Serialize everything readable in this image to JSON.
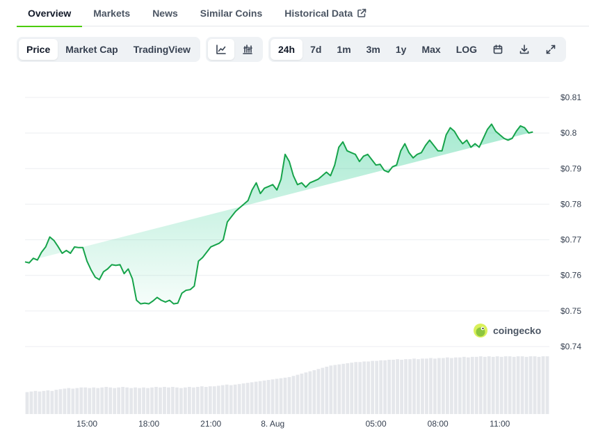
{
  "nav": {
    "tabs": [
      {
        "label": "Overview",
        "active": true
      },
      {
        "label": "Markets",
        "active": false
      },
      {
        "label": "News",
        "active": false
      },
      {
        "label": "Similar Coins",
        "active": false
      },
      {
        "label": "Historical Data",
        "active": false,
        "icon": "external-link-icon"
      }
    ]
  },
  "toolbar": {
    "chart_type": {
      "price": "Price",
      "market_cap": "Market Cap",
      "tradingview": "TradingView",
      "selected": "Price"
    },
    "view_icons": [
      "line-chart-icon",
      "candlestick-chart-icon"
    ],
    "ranges": {
      "r24h": "24h",
      "r7d": "7d",
      "r1m": "1m",
      "r3m": "3m",
      "r1y": "1y",
      "max": "Max",
      "log": "LOG",
      "selected": "24h"
    },
    "action_icons": [
      "calendar-icon",
      "download-icon",
      "fullscreen-icon"
    ]
  },
  "colors": {
    "accent": "#4bcc00",
    "line": "#16a34a",
    "area": "#16c784",
    "volume": "#e5e7eb"
  },
  "watermark": "coingecko",
  "chart_data": {
    "type": "area",
    "ylim": [
      0.74,
      0.81
    ],
    "ytick_values": [
      0.81,
      0.8,
      0.79,
      0.78,
      0.77,
      0.76,
      0.75,
      0.74
    ],
    "yticks": [
      "$0.81",
      "$0.8",
      "$0.79",
      "$0.78",
      "$0.77",
      "$0.76",
      "$0.75",
      "$0.74"
    ],
    "xticks": [
      "15:00",
      "18:00",
      "21:00",
      "8. Aug",
      "05:00",
      "08:00",
      "11:00"
    ],
    "xtick_hours": [
      15,
      18,
      21,
      24,
      29,
      32,
      35
    ],
    "series": [
      {
        "x_hours": [
          12.0,
          12.2,
          12.4,
          12.6,
          12.8,
          13.0,
          13.2,
          13.4,
          13.6,
          13.8,
          14.0,
          14.2,
          14.4,
          14.6,
          14.8,
          15.0,
          15.2,
          15.4,
          15.6,
          15.8,
          16.0,
          16.2,
          16.4,
          16.6,
          16.8,
          17.0,
          17.2,
          17.4,
          17.6,
          17.8,
          18.0,
          18.2,
          18.4,
          18.6,
          18.8,
          19.0,
          19.2,
          19.4,
          19.6,
          19.8,
          20.0,
          20.2,
          20.4,
          20.6,
          20.8,
          21.0,
          21.2,
          21.4,
          21.6,
          21.8,
          22.0,
          22.2,
          22.4,
          22.6,
          22.8,
          23.0,
          23.2,
          23.4,
          23.6,
          23.8,
          24.0,
          24.2,
          24.4,
          24.6,
          24.8,
          25.0,
          25.2,
          25.4,
          25.6,
          25.8,
          26.0,
          26.2,
          26.4,
          26.6,
          26.8,
          27.0,
          27.2,
          27.4,
          27.6,
          27.8,
          28.0,
          28.2,
          28.4,
          28.6,
          28.8,
          29.0,
          29.2,
          29.4,
          29.6,
          29.8,
          30.0,
          30.2,
          30.4,
          30.6,
          30.8,
          31.0,
          31.2,
          31.4,
          31.6,
          31.8,
          32.0,
          32.2,
          32.4,
          32.6,
          32.8,
          33.0,
          33.2,
          33.4,
          33.6,
          33.8,
          34.0,
          34.2,
          34.4,
          34.6,
          34.8,
          35.0,
          35.2,
          35.4,
          35.6,
          35.8,
          36.0,
          36.2,
          36.4,
          36.6,
          36.8,
          37.0,
          37.2,
          37.4
        ],
        "values": [
          0.7638,
          0.7635,
          0.7648,
          0.7643,
          0.7665,
          0.768,
          0.7708,
          0.7698,
          0.7681,
          0.7662,
          0.767,
          0.7662,
          0.768,
          0.7678,
          0.7678,
          0.764,
          0.7615,
          0.7595,
          0.7588,
          0.761,
          0.7618,
          0.763,
          0.7628,
          0.763,
          0.7605,
          0.7618,
          0.759,
          0.753,
          0.752,
          0.7522,
          0.752,
          0.7528,
          0.7538,
          0.753,
          0.7525,
          0.753,
          0.752,
          0.7522,
          0.755,
          0.7558,
          0.756,
          0.757,
          0.764,
          0.765,
          0.7665,
          0.768,
          0.7685,
          0.769,
          0.77,
          0.775,
          0.7765,
          0.778,
          0.779,
          0.78,
          0.781,
          0.784,
          0.786,
          0.783,
          0.7845,
          0.785,
          0.7855,
          0.784,
          0.787,
          0.794,
          0.792,
          0.788,
          0.7855,
          0.786,
          0.7848,
          0.786,
          0.7865,
          0.787,
          0.788,
          0.789,
          0.788,
          0.791,
          0.796,
          0.7975,
          0.795,
          0.7945,
          0.794,
          0.792,
          0.7935,
          0.794,
          0.7925,
          0.791,
          0.7912,
          0.7895,
          0.789,
          0.7905,
          0.791,
          0.795,
          0.797,
          0.7945,
          0.793,
          0.794,
          0.7945,
          0.7965,
          0.798,
          0.7965,
          0.795,
          0.795,
          0.7995,
          0.8015,
          0.8005,
          0.7985,
          0.797,
          0.798,
          0.796,
          0.797,
          0.796,
          0.7985,
          0.801,
          0.8025,
          0.8005,
          0.7995,
          0.7985,
          0.798,
          0.7985,
          0.8005,
          0.802,
          0.8015,
          0.8,
          0.8003
        ]
      }
    ],
    "volume": [
      0.38,
      0.39,
      0.4,
      0.39,
      0.4,
      0.41,
      0.4,
      0.42,
      0.43,
      0.44,
      0.45,
      0.44,
      0.45,
      0.46,
      0.46,
      0.45,
      0.46,
      0.45,
      0.46,
      0.47,
      0.46,
      0.45,
      0.46,
      0.47,
      0.46,
      0.45,
      0.46,
      0.45,
      0.46,
      0.45,
      0.46,
      0.47,
      0.46,
      0.47,
      0.46,
      0.47,
      0.46,
      0.45,
      0.46,
      0.47,
      0.46,
      0.47,
      0.48,
      0.47,
      0.48,
      0.48,
      0.49,
      0.5,
      0.51,
      0.5,
      0.51,
      0.52,
      0.53,
      0.54,
      0.55,
      0.56,
      0.57,
      0.58,
      0.59,
      0.6,
      0.61,
      0.62,
      0.63,
      0.64,
      0.66,
      0.68,
      0.7,
      0.72,
      0.74,
      0.76,
      0.78,
      0.8,
      0.82,
      0.84,
      0.85,
      0.86,
      0.87,
      0.88,
      0.89,
      0.9,
      0.9,
      0.91,
      0.91,
      0.92,
      0.92,
      0.93,
      0.93,
      0.94,
      0.94,
      0.95,
      0.94,
      0.95,
      0.95,
      0.96,
      0.95,
      0.96,
      0.96,
      0.97,
      0.96,
      0.97,
      0.97,
      0.98,
      0.97,
      0.98,
      0.98,
      0.99,
      0.98,
      0.99,
      0.99,
      1.0,
      0.99,
      1.0,
      0.99,
      1.0,
      0.99,
      1.0,
      1.0,
      0.99,
      1.0,
      1.0,
      0.99,
      1.0,
      1.0,
      0.99,
      1.0,
      1.0
    ]
  }
}
